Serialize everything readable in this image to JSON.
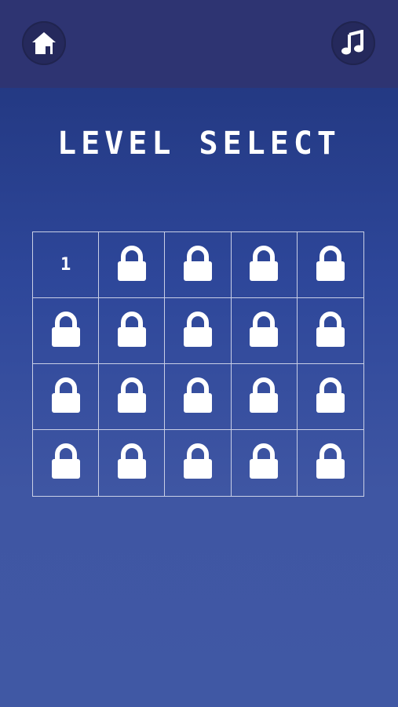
{
  "header": {
    "home_icon": "home-icon",
    "music_icon": "music-note-icon"
  },
  "title": "LEVEL SELECT",
  "levels": [
    {
      "label": "1",
      "locked": false
    },
    {
      "label": "",
      "locked": true
    },
    {
      "label": "",
      "locked": true
    },
    {
      "label": "",
      "locked": true
    },
    {
      "label": "",
      "locked": true
    },
    {
      "label": "",
      "locked": true
    },
    {
      "label": "",
      "locked": true
    },
    {
      "label": "",
      "locked": true
    },
    {
      "label": "",
      "locked": true
    },
    {
      "label": "",
      "locked": true
    },
    {
      "label": "",
      "locked": true
    },
    {
      "label": "",
      "locked": true
    },
    {
      "label": "",
      "locked": true
    },
    {
      "label": "",
      "locked": true
    },
    {
      "label": "",
      "locked": true
    },
    {
      "label": "",
      "locked": true
    },
    {
      "label": "",
      "locked": true
    },
    {
      "label": "",
      "locked": true
    },
    {
      "label": "",
      "locked": true
    },
    {
      "label": "",
      "locked": true
    }
  ],
  "colors": {
    "background": "#3f56a3",
    "topbar": "#2e3472",
    "text": "#ffffff"
  }
}
